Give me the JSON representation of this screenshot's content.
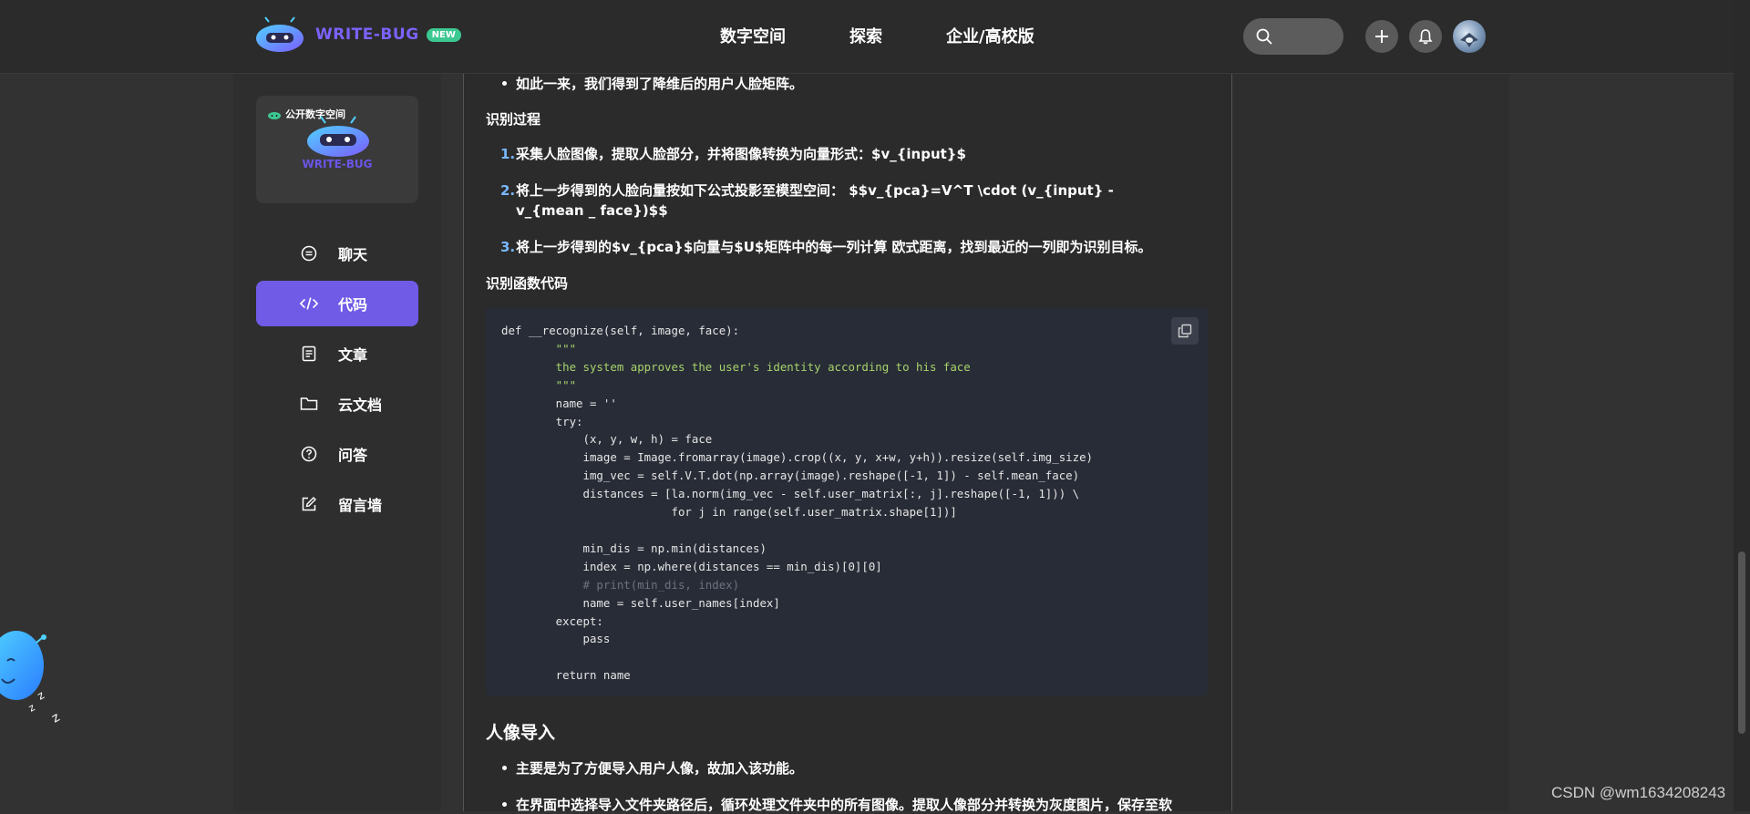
{
  "header": {
    "logo_text": "WRITE-BUG",
    "logo_badge": "NEW",
    "nav": [
      "数字空间",
      "探索",
      "企业/高校版"
    ],
    "icons": [
      "search-icon",
      "plus-icon",
      "bell-icon"
    ]
  },
  "sidebar": {
    "card_tag": "公开数字空间",
    "card_logo": "WRITE-BUG",
    "items": [
      {
        "label": "聊天",
        "icon": "chat-icon"
      },
      {
        "label": "代码",
        "icon": "code-icon",
        "active": true
      },
      {
        "label": "文章",
        "icon": "document-icon"
      },
      {
        "label": "云文档",
        "icon": "folder-icon"
      },
      {
        "label": "问答",
        "icon": "question-icon"
      },
      {
        "label": "留言墙",
        "icon": "edit-icon"
      }
    ]
  },
  "article": {
    "bullet_top": "如此一来，我们得到了降维后的用户人脸矩阵。",
    "recognize_heading": "识别过程",
    "steps": [
      "采集人脸图像，提取人脸部分，并将图像转换为向量形式：$v_{input}$",
      "将上一步得到的人脸向量按如下公式投影至模型空间： $$v_{pca}=V^T \\cdot (v_{input} - v_{mean _ face})$$",
      "将上一步得到的$v_{pca}$向量与$U$矩阵中的每一列计算 欧式距离，找到最近的一列即为识别目标。"
    ],
    "step_numbers": [
      "1.",
      "2.",
      "3."
    ],
    "code_heading": "识别函数代码",
    "section_title": "人像导入",
    "bullets_bottom": [
      "主要是为了方便导入用户人像，故加入该功能。",
      "在界面中选择导入文件夹路径后，循环处理文件夹中的所有图像。提取人像部分并转换为灰度图片，保存至软"
    ]
  },
  "code": {
    "lines": [
      "def __recognize(self, image, face):",
      "        \"\"\"",
      "        the system approves the user's identity according to his face",
      "        \"\"\"",
      "        name = ''",
      "        try:",
      "            (x, y, w, h) = face",
      "            image = Image.fromarray(image).crop((x, y, x+w, y+h)).resize(self.img_size)",
      "            img_vec = self.V.T.dot(np.array(image).reshape([-1, 1]) - self.mean_face)",
      "            distances = [la.norm(img_vec - self.user_matrix[:, j].reshape([-1, 1])) \\",
      "                         for j in range(self.user_matrix.shape[1])]",
      "",
      "            min_dis = np.min(distances)",
      "            index = np.where(distances == min_dis)[0][0]",
      "            # print(min_dis, index)",
      "            name = self.user_names[index]",
      "        except:",
      "            pass",
      "",
      "        return name"
    ]
  },
  "watermark": "CSDN @wm1634208243",
  "colors": {
    "accent": "#6f5be6",
    "badge": "#3cc891",
    "code_bg": "#282c37",
    "keyword": "#e06c4a",
    "string": "#a7d36a"
  }
}
